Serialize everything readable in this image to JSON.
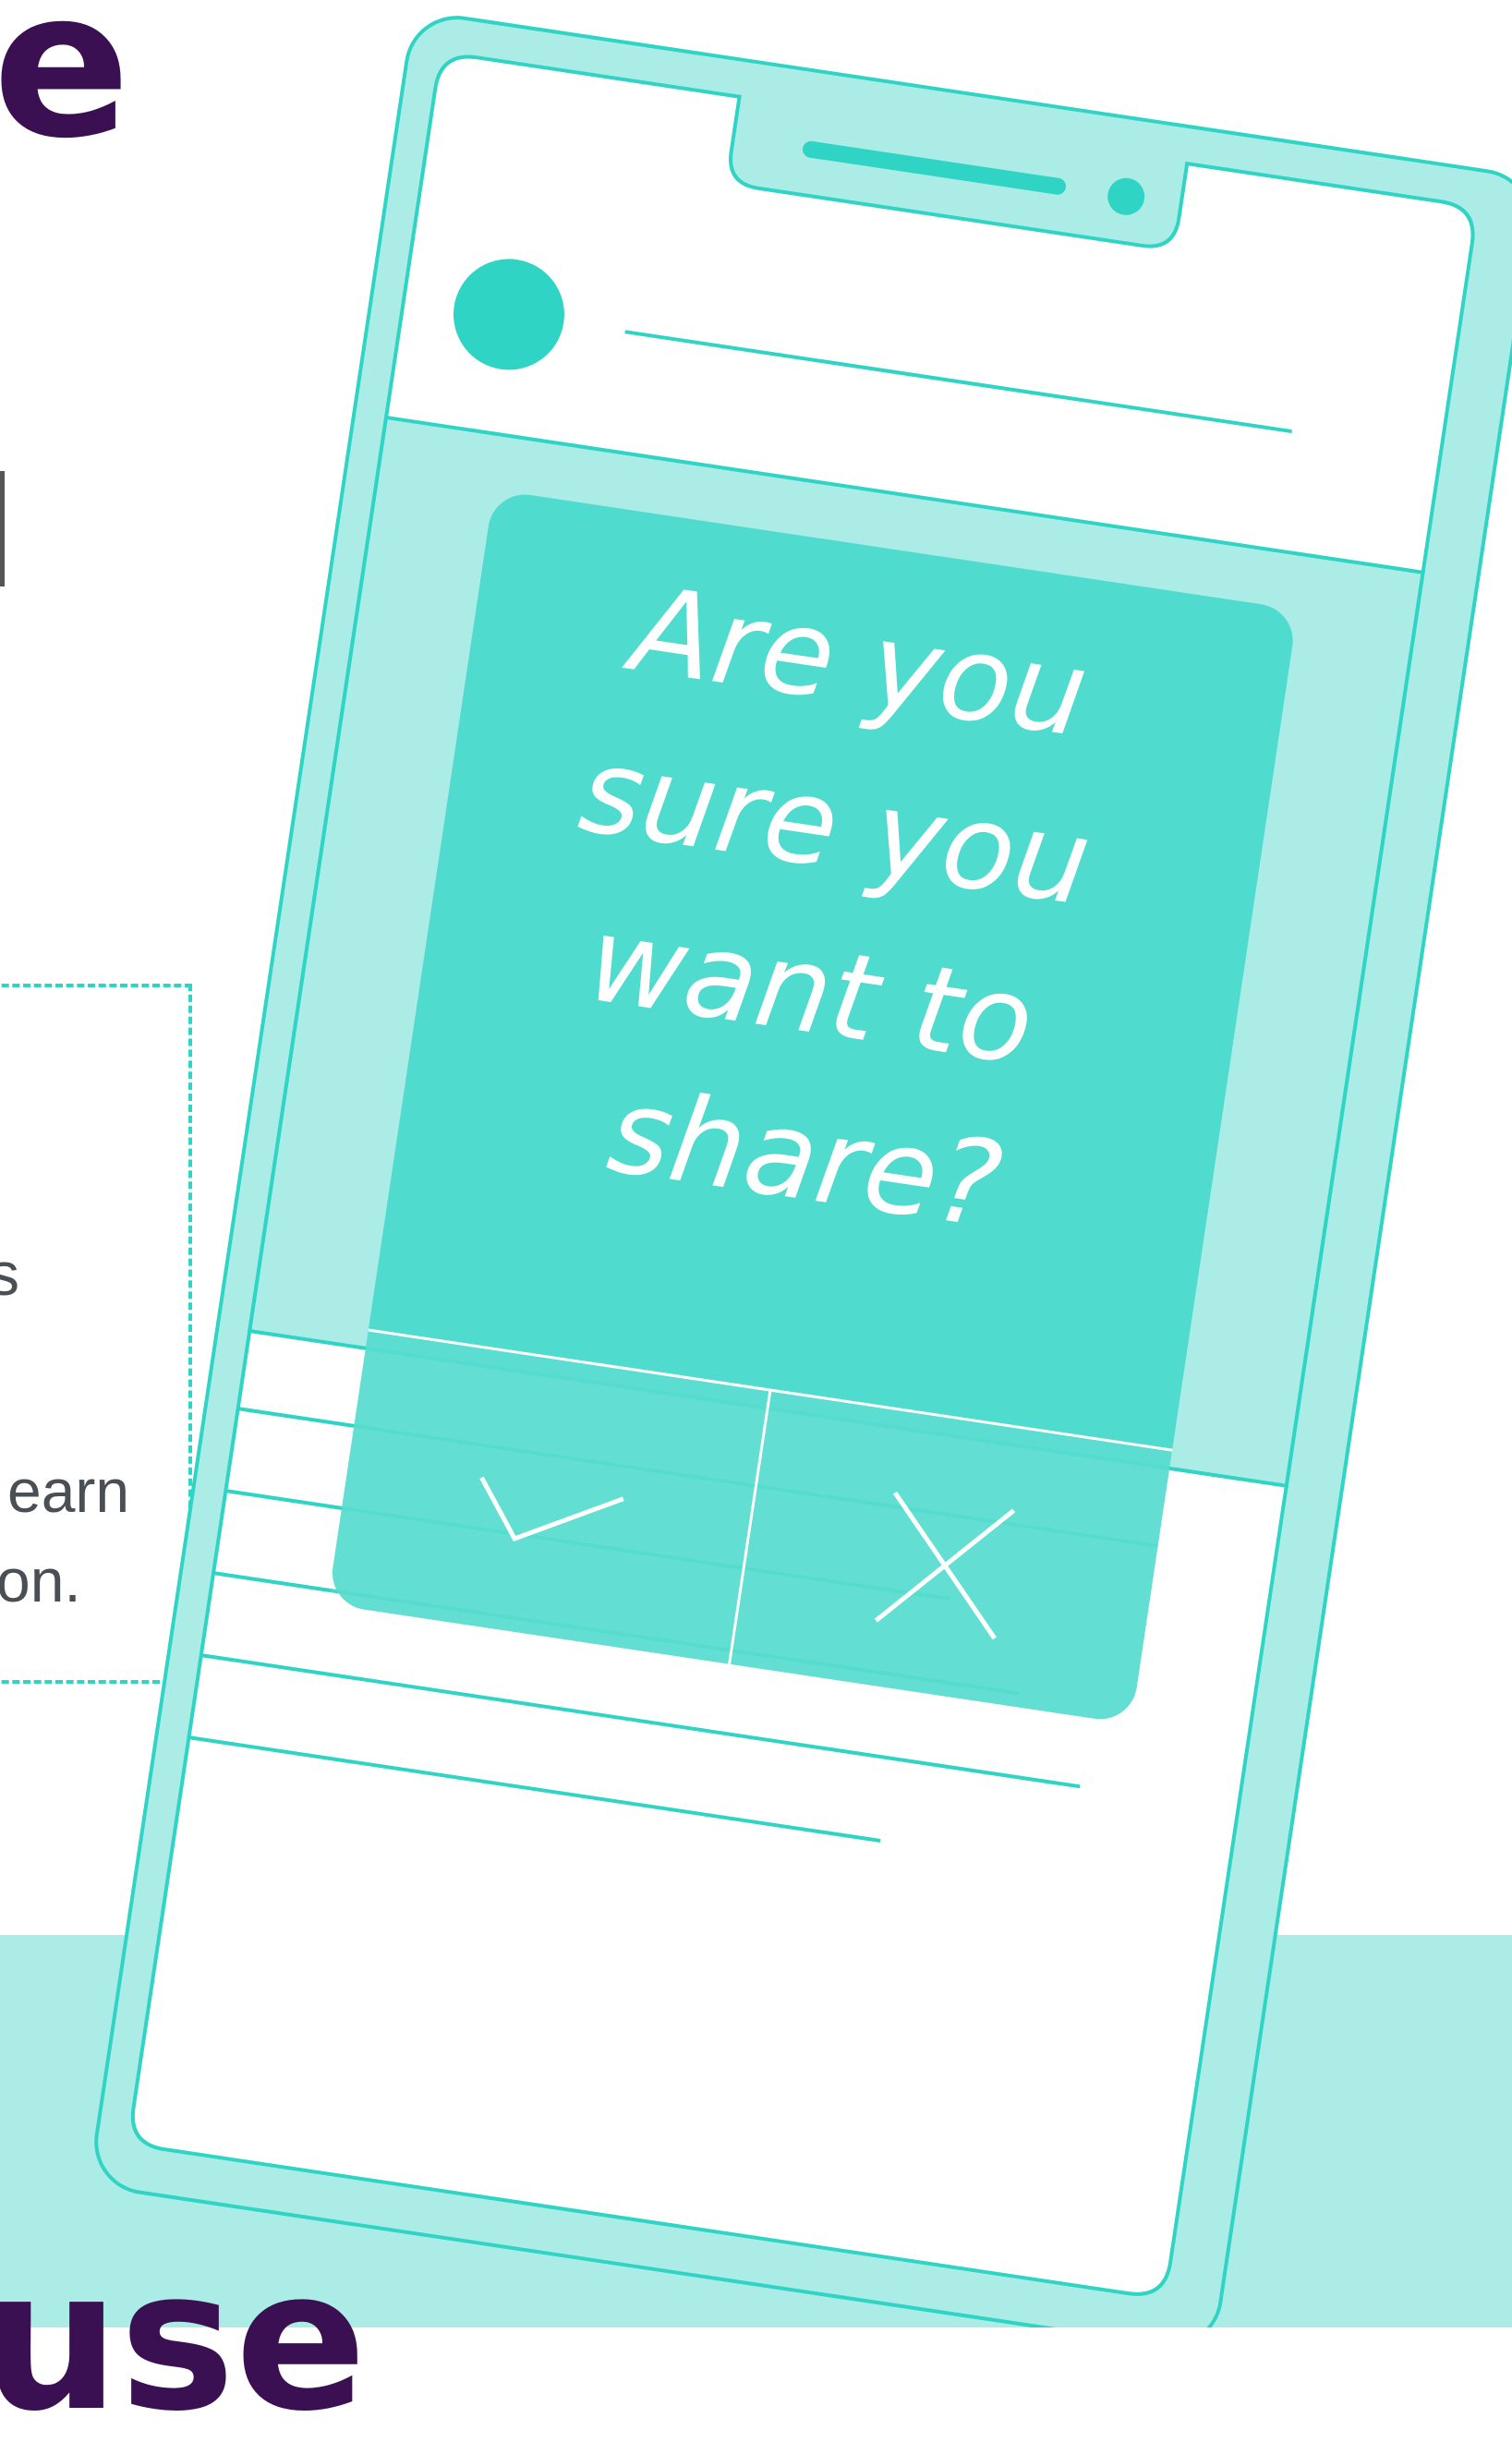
{
  "heading": {
    "top_fragment": "e",
    "bottom_fragment": "use"
  },
  "body_text": {
    "fragment_1": "s",
    "fragment_2": "earn",
    "fragment_3": "on."
  },
  "dialog": {
    "question_lines": [
      "Are you",
      "sure you",
      "want to",
      "share?"
    ],
    "confirm_icon": "check-icon",
    "cancel_icon": "close-icon"
  },
  "colors": {
    "heading": "#3a1052",
    "accent": "#2fd4c4",
    "phone_body": "#abede6",
    "dialog": "#48d9cb",
    "band": "#abede6"
  }
}
